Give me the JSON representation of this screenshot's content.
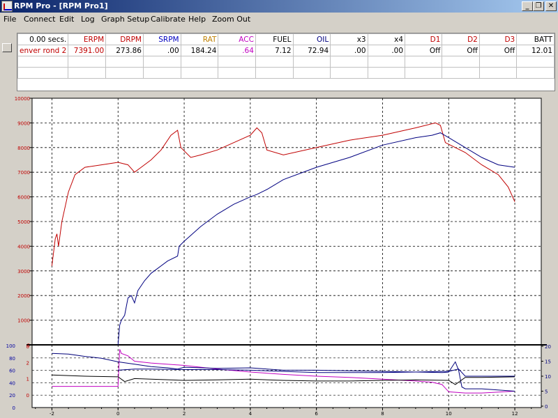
{
  "window": {
    "title": "RPM Pro - [RPM Pro1]",
    "minimize": "_",
    "restore": "❐",
    "close": "✕"
  },
  "menu": [
    "File",
    "Connect",
    "Edit",
    "Log",
    "Graph Setup",
    "Calibrate",
    "Help",
    "Zoom Out"
  ],
  "grid": {
    "headers": [
      "0.00 secs.",
      "ERPM",
      "DRPM",
      "SRPM",
      "RAT",
      "ACC",
      "FUEL",
      "OIL",
      "x3",
      "x4",
      "D1",
      "D2",
      "D3",
      "BATT"
    ],
    "header_colors": [
      "#000000",
      "#c00000",
      "#c00000",
      "#0000c0",
      "#c08000",
      "#c000c0",
      "#000000",
      "#000080",
      "#000000",
      "#000000",
      "#c00000",
      "#c00000",
      "#c00000",
      "#000000"
    ],
    "row": [
      "enver rond 2",
      "7391.00",
      "273.86",
      ".00",
      "184.24",
      ".64",
      "7.12",
      "72.94",
      ".00",
      ".00",
      "Off",
      "Off",
      "Off",
      "12.01"
    ],
    "row_colors": [
      "#c00000",
      "#c00000",
      "#000000",
      "#000000",
      "#000000",
      "#c000c0",
      "#000000",
      "#000000",
      "#000000",
      "#000000",
      "#000000",
      "#000000",
      "#000000",
      "#000000"
    ]
  },
  "chart_data": {
    "type": "line",
    "upper": {
      "yticks": [
        "10000",
        "9000",
        "8000",
        "7000",
        "6000",
        "5000",
        "4000",
        "3000",
        "2000",
        "1000",
        "0"
      ],
      "ylim": [
        0,
        10000
      ],
      "series": [
        {
          "color": "#c00000",
          "x": [
            -2,
            -1.9,
            -1.85,
            -1.8,
            -1.7,
            -1.6,
            -1.5,
            -1.3,
            -1,
            -0.5,
            0,
            0.3,
            0.5,
            0.7,
            1,
            1.3,
            1.6,
            1.8,
            1.9,
            2.2,
            2.5,
            3,
            3.5,
            4,
            4.2,
            4.35,
            4.5,
            5,
            6,
            7,
            8,
            9,
            9.6,
            9.75,
            9.9,
            10.2,
            10.5,
            11,
            11.5,
            11.8,
            12
          ],
          "y": [
            3200,
            4300,
            4500,
            4000,
            5000,
            5600,
            6200,
            6900,
            7200,
            7300,
            7400,
            7300,
            7000,
            7200,
            7500,
            7900,
            8500,
            8700,
            8000,
            7600,
            7700,
            7900,
            8200,
            8500,
            8800,
            8600,
            7900,
            7700,
            8000,
            8300,
            8500,
            8800,
            9000,
            8900,
            8200,
            8000,
            7800,
            7300,
            6900,
            6400,
            5800
          ]
        },
        {
          "color": "#000080",
          "x": [
            0,
            0.05,
            0.1,
            0.2,
            0.3,
            0.4,
            0.5,
            0.6,
            0.8,
            1,
            1.5,
            1.8,
            1.85,
            2,
            2.5,
            3,
            3.5,
            4,
            4.2,
            4.5,
            5,
            6,
            7,
            8,
            9,
            9.5,
            9.75,
            10,
            10.5,
            11,
            11.5,
            12
          ],
          "y": [
            0,
            800,
            1000,
            1200,
            1900,
            2000,
            1700,
            2200,
            2600,
            2900,
            3400,
            3600,
            4000,
            4200,
            4800,
            5300,
            5700,
            6000,
            6100,
            6300,
            6700,
            7200,
            7600,
            8100,
            8400,
            8500,
            8600,
            8400,
            8000,
            7600,
            7300,
            7200
          ]
        }
      ]
    },
    "lower": {
      "left_yticks": [
        "100",
        "80",
        "60",
        "40",
        "20",
        "0"
      ],
      "left_ylim": [
        0,
        100
      ],
      "left_red_ticks": [
        "0",
        "2",
        "1",
        "0"
      ],
      "right_yticks": [
        "20",
        "15",
        "10",
        "5",
        "0"
      ],
      "right_ylim": [
        0,
        20
      ],
      "series": [
        {
          "color": "#c000c0",
          "x": [
            -2,
            -1,
            0,
            0.05,
            0.1,
            0.3,
            0.5,
            1,
            2,
            3,
            4,
            5,
            6,
            7,
            8,
            9,
            9.5,
            9.8,
            10,
            10.5,
            11,
            12
          ],
          "y": [
            33,
            33,
            33,
            95,
            88,
            84,
            75,
            72,
            68,
            62,
            57,
            53,
            50,
            48,
            45,
            42,
            40,
            36,
            24,
            22,
            22,
            25
          ]
        },
        {
          "color": "#00007a",
          "x": [
            -2,
            -1.5,
            -1,
            -0.5,
            0,
            0.5,
            1,
            1.5,
            1.8,
            2,
            3,
            4,
            5,
            6,
            7,
            8,
            9,
            9.8,
            10,
            10.2,
            10.3,
            10.4,
            10.5,
            11,
            12
          ],
          "y": [
            88,
            87,
            83,
            80,
            74,
            70,
            66,
            64,
            62,
            65,
            63,
            64,
            60,
            60,
            59,
            58,
            57,
            56,
            57,
            74,
            60,
            32,
            29,
            29,
            25
          ]
        },
        {
          "color": "#000000",
          "x": [
            -2,
            -1,
            0,
            0.2,
            0.5,
            1,
            2,
            3,
            4,
            5,
            6,
            7,
            8,
            9,
            10,
            10.2,
            10.5,
            11,
            12
          ],
          "y": [
            52,
            50,
            49,
            41,
            46,
            45,
            43,
            44,
            45,
            43,
            42,
            42,
            43,
            44,
            43,
            36,
            48,
            48,
            49
          ]
        },
        {
          "color": "#000080",
          "x": [
            0,
            0.5,
            1,
            2,
            3,
            4,
            5,
            6,
            7,
            8,
            9,
            9.8,
            10,
            10.3,
            10.5,
            11,
            12
          ],
          "y": [
            60,
            62,
            62,
            61,
            61,
            60,
            58,
            56,
            56,
            56,
            57,
            58,
            58,
            62,
            50,
            50,
            50
          ]
        }
      ]
    },
    "xticks": [
      "-2",
      "0",
      "2",
      "4",
      "6",
      "8",
      "10",
      "12"
    ],
    "xlim": [
      -2.6,
      12.8
    ]
  }
}
